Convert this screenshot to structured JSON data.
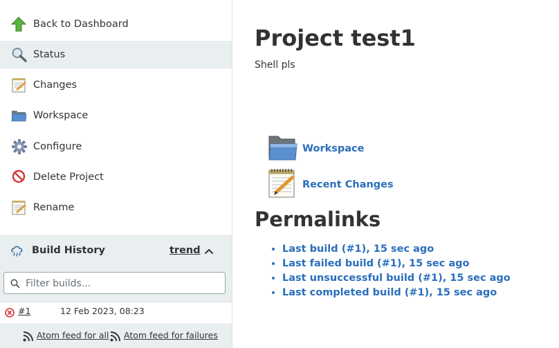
{
  "sidebar": {
    "tasks": [
      {
        "label": "Back to Dashboard",
        "icon": "up-arrow-icon"
      },
      {
        "label": "Status",
        "icon": "magnifier-icon"
      },
      {
        "label": "Changes",
        "icon": "notepad-icon"
      },
      {
        "label": "Workspace",
        "icon": "folder-icon"
      },
      {
        "label": "Configure",
        "icon": "gear-icon"
      },
      {
        "label": "Delete Project",
        "icon": "no-entry-icon"
      },
      {
        "label": "Rename",
        "icon": "notepad-icon"
      }
    ],
    "active_task": "Status"
  },
  "build_history": {
    "title": "Build History",
    "trend_label": "trend",
    "filter_placeholder": "Filter builds...",
    "builds": [
      {
        "number": "#1",
        "timestamp": "12 Feb 2023, 08:23",
        "status": "failed"
      }
    ],
    "feed_all": "Atom feed for all",
    "feed_failures": "Atom feed for failures"
  },
  "main": {
    "title": "Project test1",
    "description": "Shell pls",
    "links": [
      {
        "label": "Workspace",
        "icon": "large-folder-icon"
      },
      {
        "label": "Recent Changes",
        "icon": "large-notepad-icon"
      }
    ],
    "permalinks_title": "Permalinks",
    "permalinks": [
      "Last build (#1), 15 sec ago",
      "Last failed build (#1), 15 sec ago",
      "Last unsuccessful build (#1), 15 sec ago",
      "Last completed build (#1), 15 sec ago"
    ]
  },
  "colors": {
    "link": "#2a6ebb",
    "sidebar_highlight": "#e9eef0",
    "failed": "#d23535"
  }
}
